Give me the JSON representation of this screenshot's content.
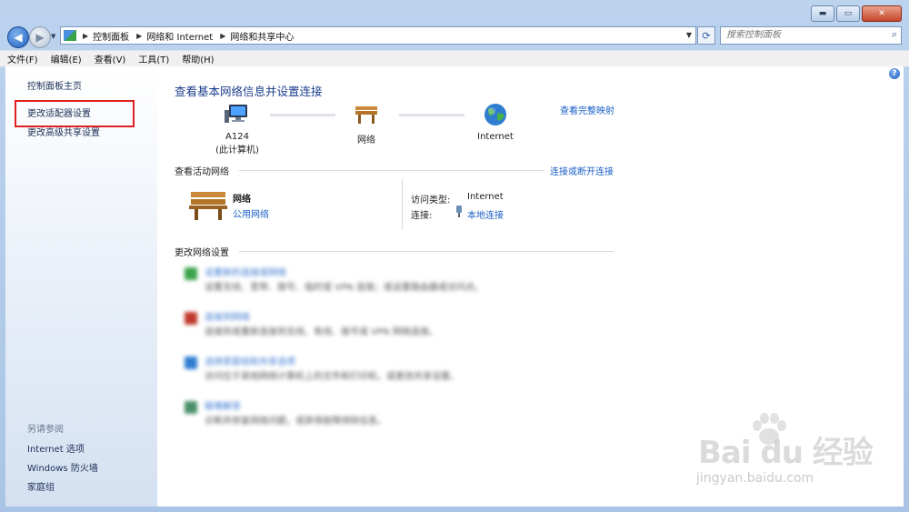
{
  "window": {
    "min_label": "▬",
    "max_label": "▭",
    "close_label": "✕"
  },
  "address": {
    "crumbs": [
      "控制面板",
      "网络和 Internet",
      "网络和共享中心"
    ],
    "search_placeholder": "搜索控制面板"
  },
  "menu": [
    "文件(F)",
    "编辑(E)",
    "查看(V)",
    "工具(T)",
    "帮助(H)"
  ],
  "sidebar": {
    "links": [
      "控制面板主页",
      "更改适配器设置",
      "更改高级共享设置"
    ],
    "see_also_title": "另请参阅",
    "see_also": [
      "Internet 选项",
      "Windows 防火墙",
      "家庭组"
    ]
  },
  "main": {
    "heading": "查看基本网络信息并设置连接",
    "full_map_link": "查看完整映射",
    "nodes": [
      {
        "label": "A124",
        "sublabel": "(此计算机)",
        "icon": "computer-icon"
      },
      {
        "label": "网络",
        "sublabel": "",
        "icon": "bench-icon"
      },
      {
        "label": "Internet",
        "sublabel": "",
        "icon": "globe-icon"
      }
    ],
    "active_section_title": "查看活动网络",
    "connect_link": "连接或断开连接",
    "network_name": "网络",
    "network_type": "公用网络",
    "access_type_label": "访问类型:",
    "access_type_value": "Internet",
    "connection_label": "连接:",
    "connection_value": "本地连接",
    "change_section_title": "更改网络设置",
    "tasks": [
      {
        "title": "设置新的连接或网络",
        "desc": "设置无线、宽带、拨号、临时或 VPN 连接；或设置路由器或访问点。",
        "icon_color": "#3aa34a"
      },
      {
        "title": "连接到网络",
        "desc": "连接到或重新连接到无线、有线、拨号或 VPN 网络连接。",
        "icon_color": "#c0392b"
      },
      {
        "title": "选择家庭组和共享选项",
        "desc": "访问位于其他网络计算机上的文件和打印机，或更改共享设置。",
        "icon_color": "#2f7dd1"
      },
      {
        "title": "疑难解答",
        "desc": "诊断并修复网络问题，或获得故障排除信息。",
        "icon_color": "#4a8f6a"
      }
    ]
  },
  "watermark": {
    "logo": "Bai du 经验",
    "url": "jingyan.baidu.com"
  }
}
